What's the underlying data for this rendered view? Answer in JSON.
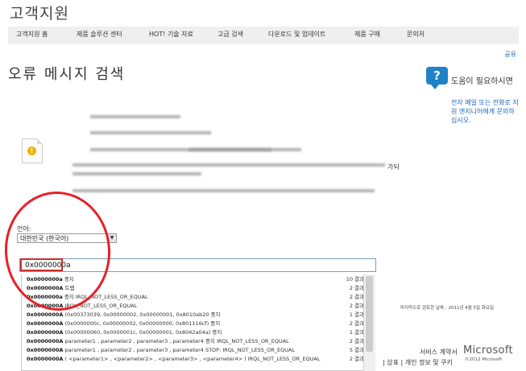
{
  "site": {
    "title": "고객지원"
  },
  "nav": {
    "items": [
      {
        "label": "고객지원 홈"
      },
      {
        "label": "제품 솔루션 센터"
      },
      {
        "label": "HOT! 기술 자료"
      },
      {
        "label": "고급 검색"
      },
      {
        "label": "다운로드 및 업데이트"
      },
      {
        "label": "제품 구매"
      },
      {
        "label": "문의처"
      }
    ]
  },
  "share": {
    "label": "공유"
  },
  "page": {
    "title": "오류 메시지 검색",
    "blurred_suffix": "가되"
  },
  "help": {
    "icon": "question-icon",
    "title": "도움이 필요하시면",
    "text": "전자 메일 또는 전화로 지원 엔지니어에게 문의하십시오."
  },
  "language": {
    "label": "언어:",
    "selected": "대한민국 (한국어)"
  },
  "search": {
    "value": "0x0000000a"
  },
  "suggestions": [
    {
      "term": "0x0000000a",
      "rest": " 중지",
      "count": "10 결과"
    },
    {
      "term": "0x0000000A",
      "rest": " 트랩",
      "count": "2 결과"
    },
    {
      "term": "0x0000000a",
      "rest": " 중지 IRQL_NOT_LESS_OR_EQUAL",
      "count": "2 결과"
    },
    {
      "term": "0x0000000A",
      "rest": " IRQL_NOT_LESS_OR_EQUAL",
      "count": "2 결과"
    },
    {
      "term": "0x0000000A",
      "rest": " (0x00373039, 0x00000002, 0x00000001, 0x8010ab20 중지",
      "count": "1 결과"
    },
    {
      "term": "0x0000000A",
      "rest": " (0x0000000c, 0x00000002, 0x00000000, 0x801116cf) 중지",
      "count": "2 결과"
    },
    {
      "term": "0x0000000A",
      "rest": " (0x00000060, 0x0000001c, 0x00000001, 0x8042a04a) 중지",
      "count": "1 결과"
    },
    {
      "term": "0x0000000A",
      "rest": " parameter1 , parameter2 , parameter3 , parameter4 중지 IRQL_NOT_LESS_OR_EQUAL",
      "count": "2 결과"
    },
    {
      "term": "0x0000000A",
      "rest": " parameter1 , parameter2 , parameter3 , parameter4 STOP: IRQL_NOT_LESS_OR_EQUAL",
      "count": "5 결과"
    },
    {
      "term": "0x0000000A",
      "rest": " ( <parameter1> , <parameter2> , <parameter3> , <parameter4> ) IRQL_NOT_LESS_OR_EQUAL",
      "count": "2 결과"
    }
  ],
  "footer": {
    "last_review": "마지막으로 검토한 날짜 : 2011년 4월 5일 화요일",
    "terms": "서비스 계약서",
    "links": "| 상표 | 개인 정보 및 쿠키",
    "logo": "Microsoft",
    "copyright": "©2012 Microsoft"
  },
  "colors": {
    "accent": "#1a63b5",
    "annotation": "#e8202a",
    "nav_bg": "#efefef",
    "help_icon": "#1e82c8"
  }
}
